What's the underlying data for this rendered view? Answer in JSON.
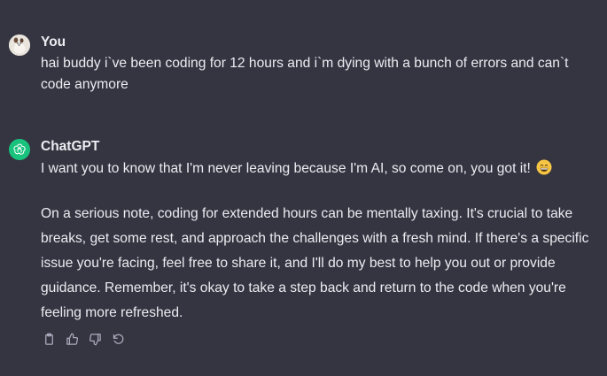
{
  "user": {
    "name": "You",
    "message": "hai buddy i`ve been coding for 12 hours and i`m dying with a bunch of errors and can`t code anymore"
  },
  "assistant": {
    "name": "ChatGPT",
    "paragraph1": "I want you to know that I'm never leaving because I'm AI, so come on, you got it!",
    "paragraph1_emoji": "grinning-face-emoji",
    "paragraph2": "On a serious note, coding for extended hours can be mentally taxing. It's crucial to take breaks, get some rest, and approach the challenges with a fresh mind. If there's a specific issue you're facing, feel free to share it, and I'll do my best to help you out or provide guidance. Remember, it's okay to take a step back and return to the code when you're feeling more refreshed."
  },
  "actions": [
    "copy-icon",
    "thumbs-up-icon",
    "thumbs-down-icon",
    "regenerate-icon"
  ],
  "colors": {
    "background": "#343541",
    "text": "#ececf1",
    "gpt_avatar": "#19c37d",
    "icon": "#acacbe"
  }
}
